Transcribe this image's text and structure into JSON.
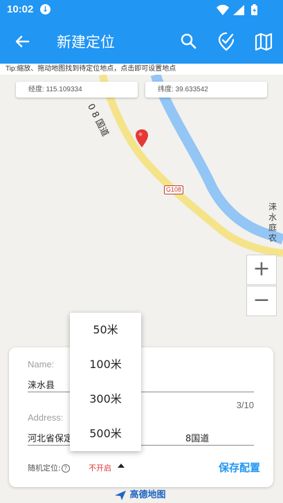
{
  "status": {
    "time": "10:02"
  },
  "toolbar": {
    "title": "新建定位"
  },
  "tip": "Tip:缩放、拖动地图找到待定位地点，点击即可设置地点",
  "coords": {
    "lng": "经度: 115.109334",
    "lat": "纬度: 39.633542"
  },
  "map": {
    "road_name": "0 8 国道",
    "road_badge": "G108",
    "village_line1": "涞水",
    "village_line2": "庭农",
    "zoom_in": "+",
    "zoom_out": "−",
    "road_color": "#f5e38a",
    "river_color": "#93c5f5"
  },
  "form": {
    "name_label": "Name:",
    "name_value": "涞水县",
    "name_counter": "3/10",
    "address_label": "Address:",
    "address_value_left": "河北省保定市",
    "address_value_right": "8国道",
    "random_label": "随机定位:",
    "random_help": "?",
    "random_value": "不开启",
    "save_label": "保存配置"
  },
  "dropdown": {
    "options": [
      "50米",
      "100米",
      "300米",
      "500米"
    ]
  },
  "footer": {
    "logo_text": "高德地图"
  },
  "colors": {
    "primary": "#2196f3",
    "accent_red": "#e53935"
  }
}
